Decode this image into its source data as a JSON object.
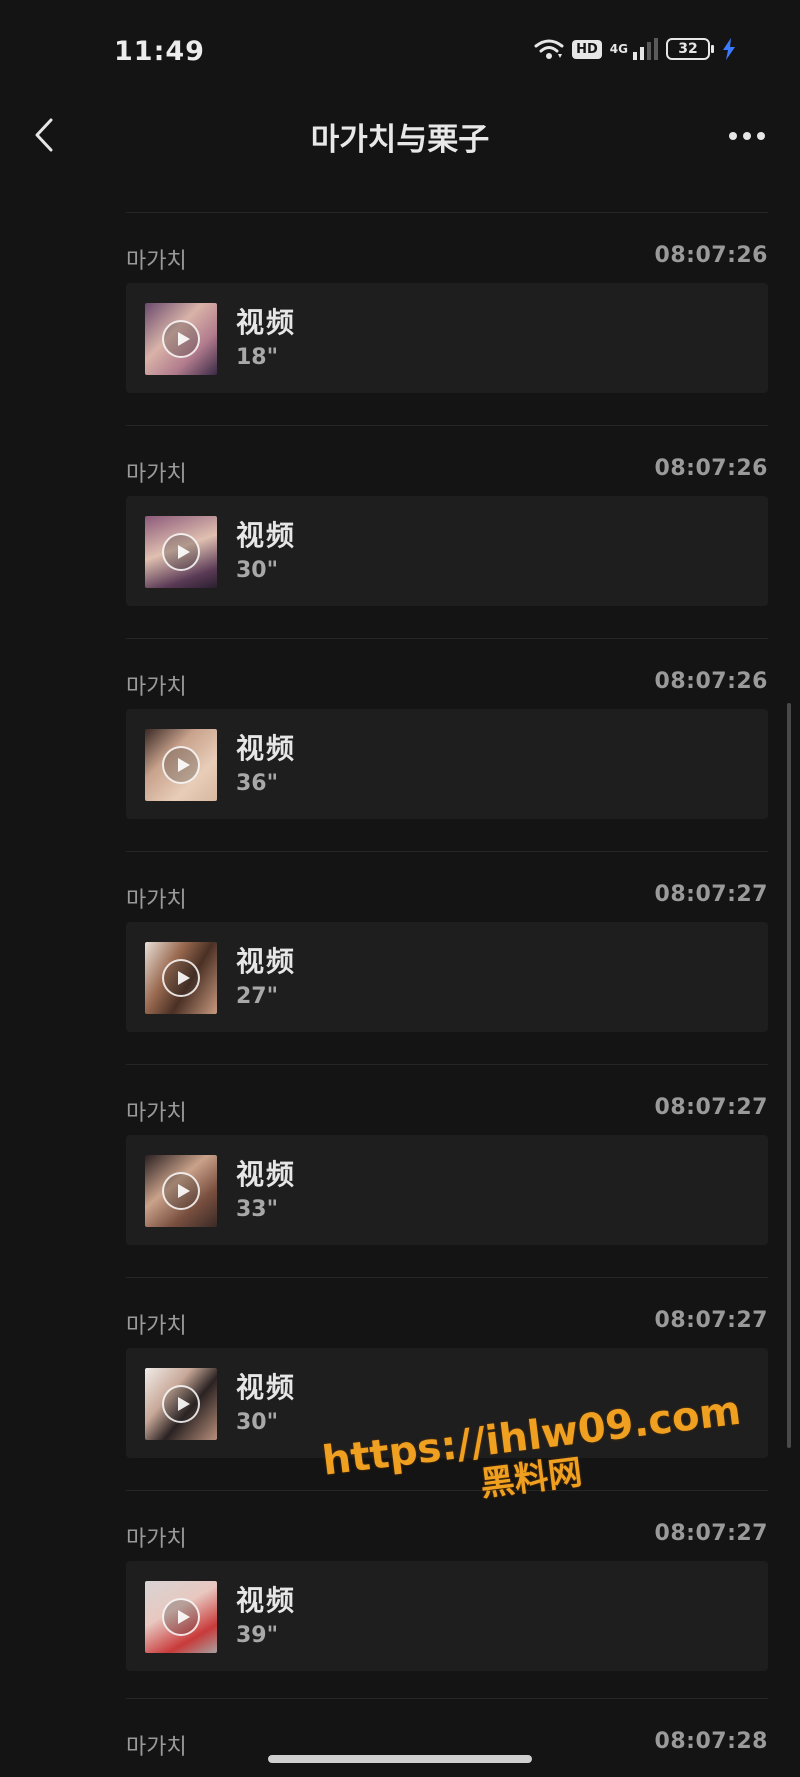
{
  "status_bar": {
    "time": "11:49",
    "hd": "HD",
    "network": "4G",
    "battery": "32",
    "icons": [
      "wifi-icon",
      "hd-badge",
      "signal-icon",
      "battery-icon",
      "charging-bolt-icon"
    ]
  },
  "header": {
    "title": "마가치与栗子",
    "back_icon": "chevron-left-icon",
    "more_icon": "more-dots-icon"
  },
  "messages": [
    {
      "sender": "마가치",
      "time": "08:07:26",
      "label": "视频",
      "duration": "18\""
    },
    {
      "sender": "마가치",
      "time": "08:07:26",
      "label": "视频",
      "duration": "30\""
    },
    {
      "sender": "마가치",
      "time": "08:07:26",
      "label": "视频",
      "duration": "36\""
    },
    {
      "sender": "마가치",
      "time": "08:07:27",
      "label": "视频",
      "duration": "27\""
    },
    {
      "sender": "마가치",
      "time": "08:07:27",
      "label": "视频",
      "duration": "33\""
    },
    {
      "sender": "마가치",
      "time": "08:07:27",
      "label": "视频",
      "duration": "30\""
    },
    {
      "sender": "마가치",
      "time": "08:07:27",
      "label": "视频",
      "duration": "39\""
    }
  ],
  "partial_message": {
    "sender": "마가치",
    "time": "08:07:28"
  },
  "watermark": {
    "url": "https://ihlw09.com",
    "name": "黑料网",
    "color": "#f0a020"
  }
}
